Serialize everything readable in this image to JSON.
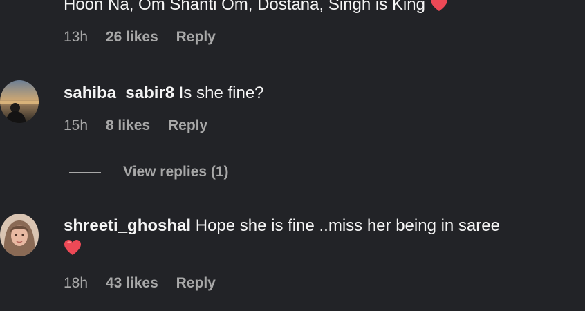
{
  "comments": [
    {
      "text": "Hoon Na, Om Shanti Om, Dostana, Singh is King",
      "time": "13h",
      "likes": "26 likes",
      "reply": "Reply"
    },
    {
      "username": "sahiba_sabir8",
      "text": "Is she fine?",
      "time": "15h",
      "likes": "8 likes",
      "reply": "Reply",
      "view_replies": "View replies (1)"
    },
    {
      "username": "shreeti_ghoshal",
      "text": "Hope she is fine ..miss her being in saree",
      "time": "18h",
      "likes": "43 likes",
      "reply": "Reply"
    }
  ],
  "colors": {
    "background": "#222327",
    "text": "#f5f5f5",
    "muted": "#a8a8a8",
    "heart": "#ed4956"
  },
  "icons": [
    "heart-emoji-icon",
    "avatar-photo"
  ]
}
